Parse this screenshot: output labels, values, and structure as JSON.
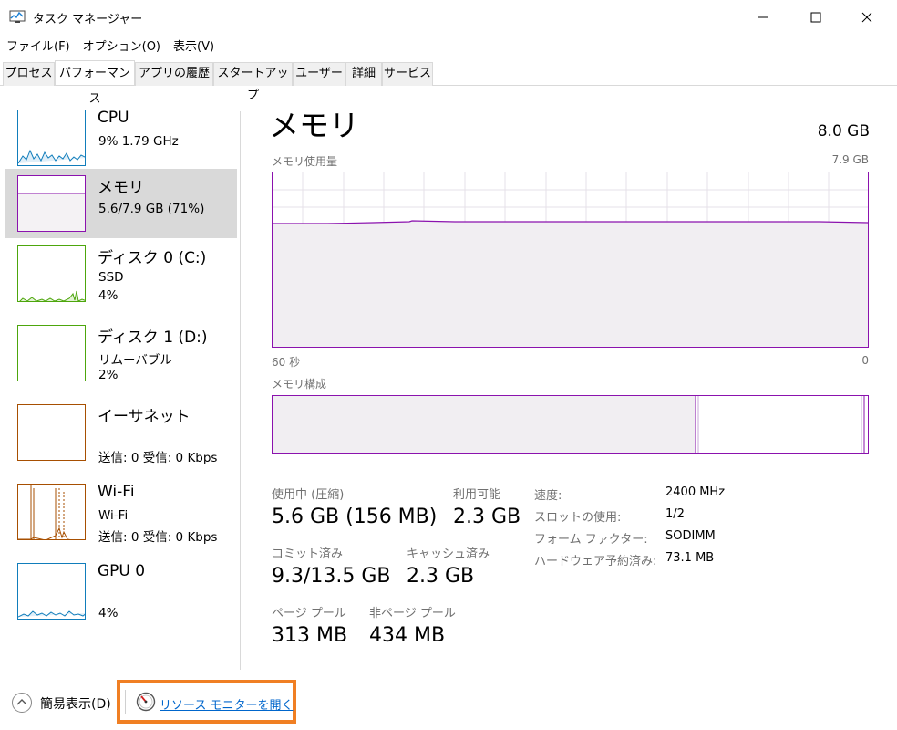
{
  "window": {
    "title": "タスク マネージャー"
  },
  "menu": [
    "ファイル(F)",
    "オプション(O)",
    "表示(V)"
  ],
  "tabs": [
    "プロセス",
    "パフォーマンス",
    "アプリの履歴",
    "スタートアップ",
    "ユーザー",
    "詳細",
    "サービス"
  ],
  "sidebar": [
    {
      "name": "CPU",
      "line2": "9% 1.79 GHz",
      "line3": "",
      "color": "#117dbb"
    },
    {
      "name": "メモリ",
      "line2": "5.6/7.9 GB (71%)",
      "line3": "",
      "color": "#8b12ae"
    },
    {
      "name": "ディスク 0 (C:)",
      "line2": "SSD",
      "line3": "4%",
      "color": "#4da60c"
    },
    {
      "name": "ディスク 1 (D:)",
      "line2": "リムーバブル",
      "line3": "2%",
      "color": "#4da60c"
    },
    {
      "name": "イーサネット",
      "line2": "",
      "line3": "送信: 0 受信: 0 Kbps",
      "color": "#a74f01"
    },
    {
      "name": "Wi-Fi",
      "line2": "Wi-Fi",
      "line3": "送信: 0 受信: 0 Kbps",
      "color": "#a74f01"
    },
    {
      "name": "GPU 0",
      "line2": "",
      "line3": "4%",
      "color": "#117dbb"
    }
  ],
  "main": {
    "title": "メモリ",
    "total": "8.0 GB",
    "usage_label": "メモリ使用量",
    "usage_max": "7.9 GB",
    "time_left": "60 秒",
    "time_right": "0",
    "composition_label": "メモリ構成",
    "usage_level_percent": 71,
    "stats": {
      "in_use_label": "使用中 (圧縮)",
      "in_use_value": "5.6 GB (156 MB)",
      "available_label": "利用可能",
      "available_value": "2.3 GB",
      "committed_label": "コミット済み",
      "committed_value": "9.3/13.5 GB",
      "cached_label": "キャッシュ済み",
      "cached_value": "2.3 GB",
      "paged_label": "ページ プール",
      "paged_value": "313 MB",
      "nonpaged_label": "非ページ プール",
      "nonpaged_value": "434 MB"
    },
    "props": {
      "speed_label": "速度:",
      "speed_value": "2400 MHz",
      "slots_label": "スロットの使用:",
      "slots_value": "1/2",
      "form_label": "フォーム ファクター:",
      "form_value": "SODIMM",
      "reserved_label": "ハードウェア予約済み:",
      "reserved_value": "73.1 MB"
    }
  },
  "footer": {
    "summary": "簡易表示(D)",
    "resmon_link": "リソース モニターを開く"
  },
  "colors": {
    "memory_purple": "#8b12ae",
    "highlight_orange": "#f07f23",
    "link_blue": "#0066cc"
  }
}
